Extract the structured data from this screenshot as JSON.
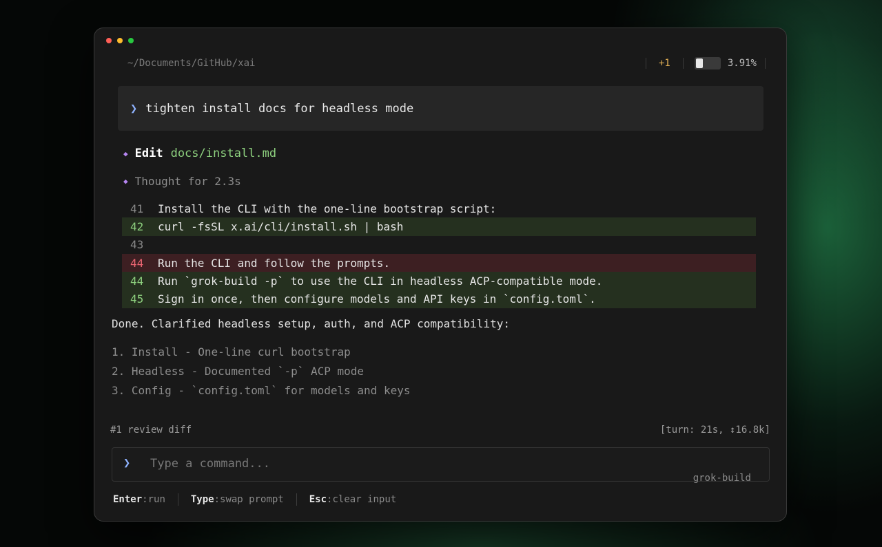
{
  "window": {
    "path": "~/Documents/GitHub/xai"
  },
  "status": {
    "changes": "+1",
    "context_usage_text": "3.91%",
    "context_fraction": 0.0391
  },
  "prompt": {
    "chevron": "❯",
    "text": "tighten install docs for headless mode"
  },
  "steps": {
    "edit": {
      "label": "Edit",
      "file": "docs/install.md"
    },
    "thought": {
      "text": "Thought for 2.3s"
    }
  },
  "diff": [
    {
      "num": "41",
      "type": "context",
      "text": "Install the CLI with the one-line bootstrap script:"
    },
    {
      "num": "42",
      "type": "add",
      "text": "curl -fsSL x.ai/cli/install.sh | bash"
    },
    {
      "num": "43",
      "type": "context",
      "text": ""
    },
    {
      "num": "44",
      "type": "del",
      "text": "Run the CLI and follow the prompts."
    },
    {
      "num": "44",
      "type": "add",
      "text": "Run `grok-build -p` to use the CLI in headless ACP-compatible mode."
    },
    {
      "num": "45",
      "type": "add",
      "text": "Sign in once, then configure models and API keys in `config.toml`."
    }
  ],
  "response": {
    "done": "Done. Clarified headless setup, auth, and ACP compatibility:",
    "items": [
      "1. Install - One-line curl bootstrap",
      "2. Headless - Documented `-p` ACP mode",
      "3. Config - `config.toml` for models and keys"
    ]
  },
  "footer": {
    "task": "#1 review diff",
    "turn_info": "[turn: 21s, ↕16.8k]"
  },
  "input": {
    "chevron": "❯",
    "placeholder": "Type a command...",
    "mode": "grok-build"
  },
  "hints": [
    {
      "key": "Enter",
      "action": ":run"
    },
    {
      "key": "Type",
      "action": ":swap prompt"
    },
    {
      "key": "Esc",
      "action": ":clear input"
    }
  ],
  "colors": {
    "accent_blue": "#8fb3ff",
    "diamond_purple": "#b686f2",
    "add_green": "#8ed17f",
    "del_red": "#ee6673",
    "changes_yellow": "#e2b055"
  }
}
